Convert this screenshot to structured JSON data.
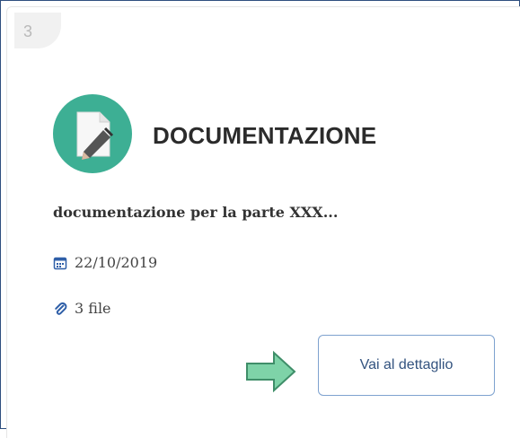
{
  "card": {
    "step_number": "3",
    "title": "DOCUMENTAZIONE",
    "description": "documentazione per la parte XXX...",
    "date": "22/10/2019",
    "files": "3 file",
    "detail_button_label": "Vai al dettaglio"
  },
  "icons": {
    "document": "document-edit-icon",
    "calendar": "calendar-icon",
    "attachment": "paperclip-icon",
    "pointer": "green-arrow-icon"
  },
  "colors": {
    "icon_circle": "#3daf94",
    "button_border": "#7ea2cf",
    "button_text": "#33537f",
    "meta_icon": "#2f5fa8",
    "arrow_fill": "#7ed3a8",
    "arrow_stroke": "#3f8e69"
  }
}
